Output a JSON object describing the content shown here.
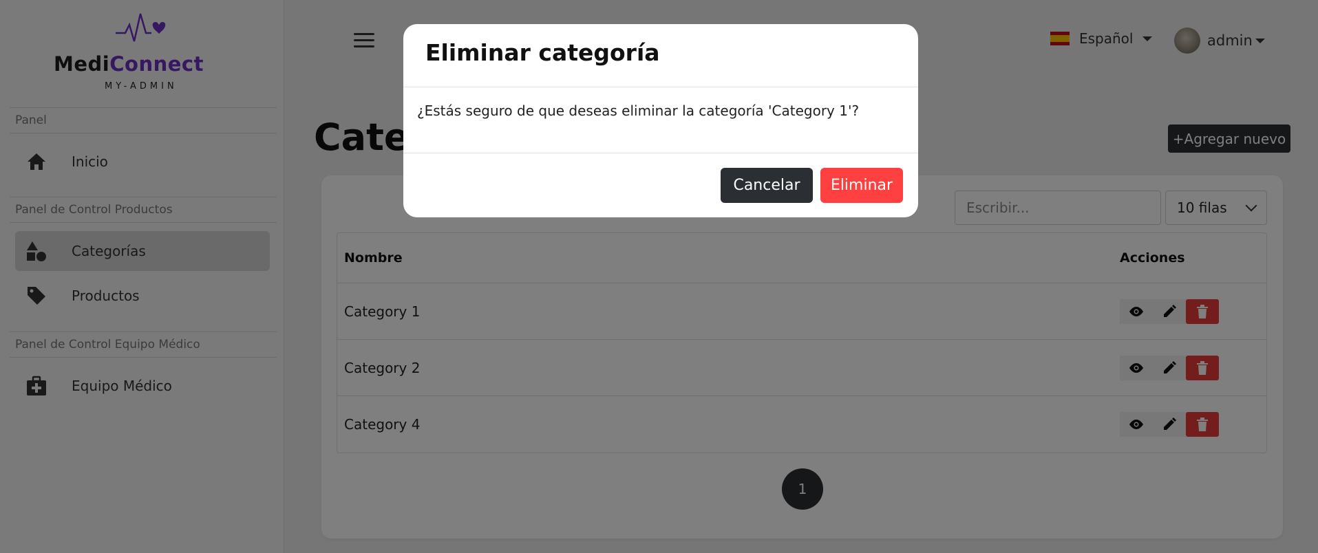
{
  "brand": {
    "name_part1": "Medi",
    "name_part2": "Connect",
    "subtitle": "MY-ADMIN"
  },
  "sidebar": {
    "sections": [
      {
        "label": "Panel"
      },
      {
        "label": "Panel de Control Productos"
      },
      {
        "label": "Panel de Control Equipo Médico"
      }
    ],
    "items": [
      {
        "label": "Inicio",
        "icon": "home-icon"
      },
      {
        "label": "Categorías",
        "icon": "shapes-icon",
        "active": true
      },
      {
        "label": "Productos",
        "icon": "tag-icon"
      },
      {
        "label": "Equipo Médico",
        "icon": "medical-kit-icon"
      }
    ]
  },
  "header": {
    "language": "Español",
    "user": "admin"
  },
  "page": {
    "title": "Categorías",
    "add_button": "+Agregar nuevo",
    "search_placeholder": "Escribir...",
    "rows_per_page": "10 filas"
  },
  "table": {
    "columns": [
      "Nombre",
      "Acciones"
    ],
    "rows": [
      {
        "name": "Category 1"
      },
      {
        "name": "Category 2"
      },
      {
        "name": "Category 4"
      }
    ]
  },
  "pagination": {
    "current": "1"
  },
  "modal": {
    "title": "Eliminar categoría",
    "message": "¿Estás seguro de que deseas eliminar la categoría 'Category 1'?",
    "cancel": "Cancelar",
    "confirm": "Eliminar"
  },
  "colors": {
    "brand_purple": "#6a2fc4",
    "danger": "#ff4040",
    "dark": "#2b2e33"
  }
}
